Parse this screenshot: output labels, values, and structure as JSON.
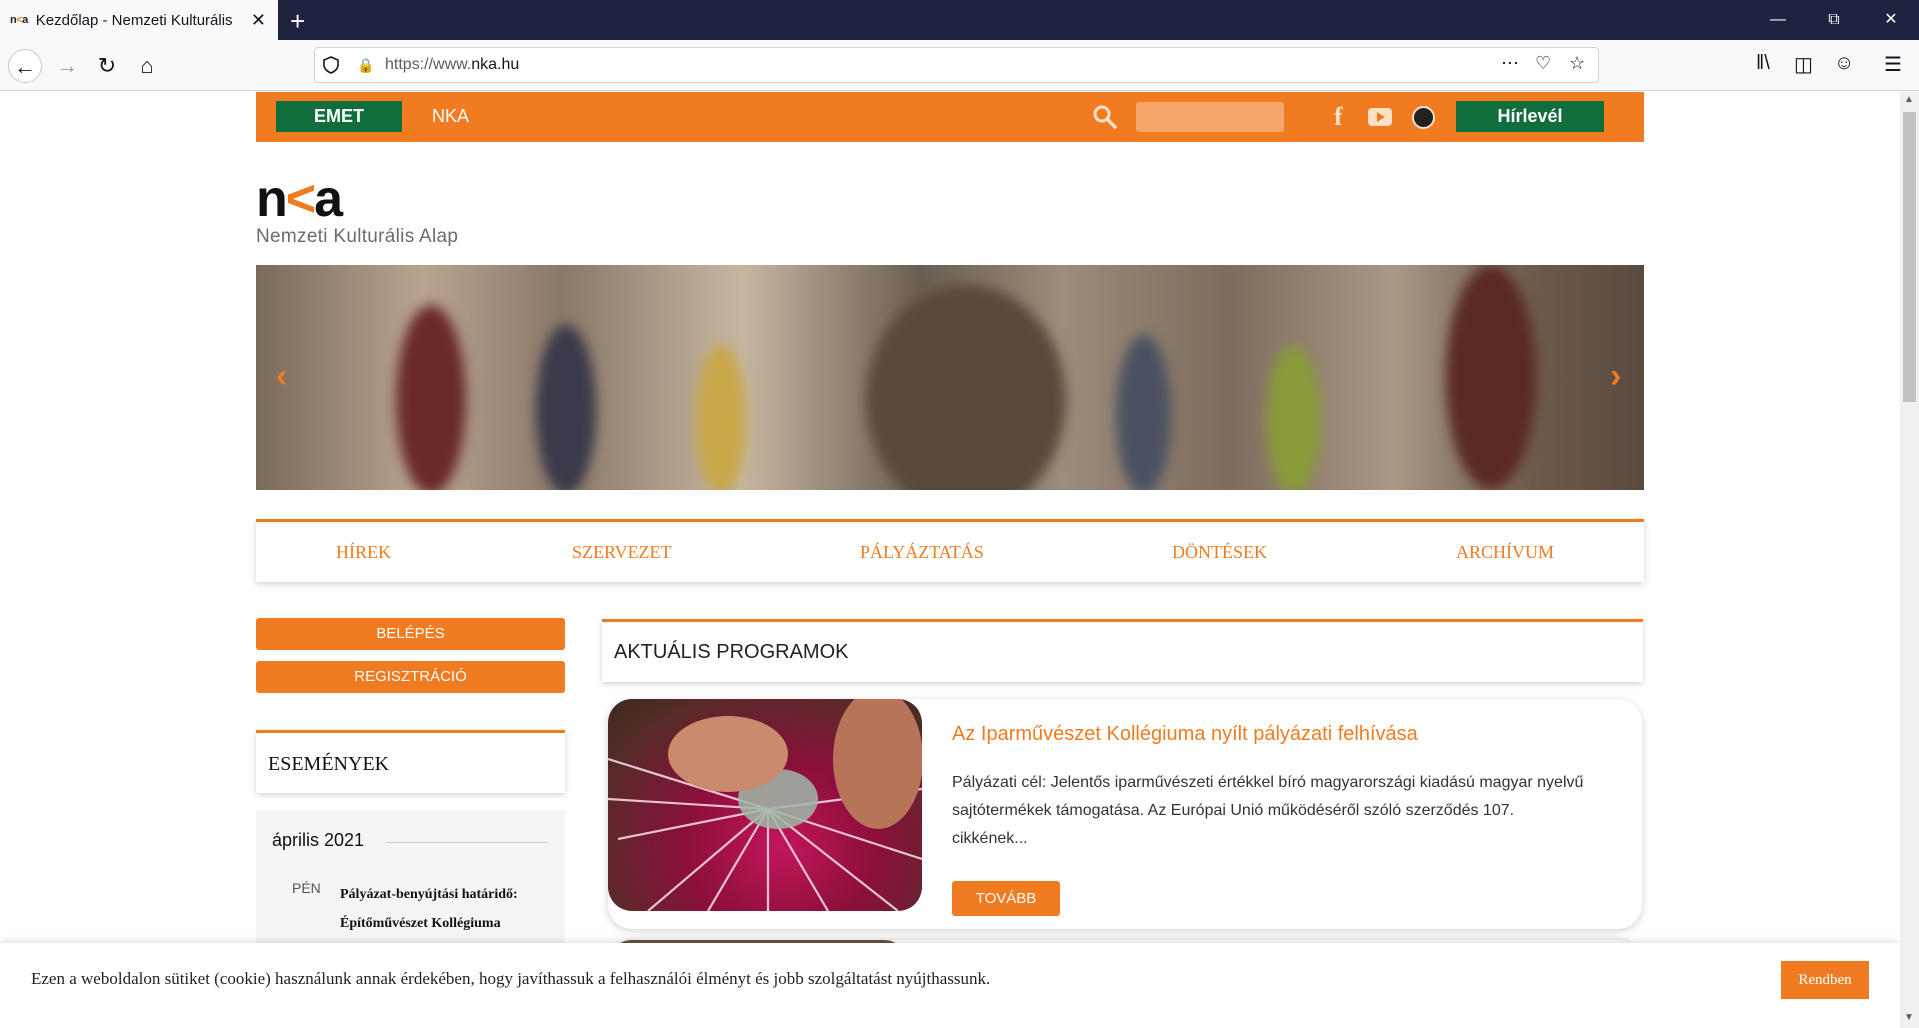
{
  "browser": {
    "tab_title": "Kezdőlap - Nemzeti Kulturális Alap",
    "url_prefix": "https://www.",
    "url_domain": "nka.hu",
    "new_tab": "+",
    "close_tab": "✕"
  },
  "topbar": {
    "emet_label": "EMET",
    "nka_label": "NKA",
    "search_placeholder": "",
    "facebook": "f",
    "newsletter_label": "Hírlevél"
  },
  "logo": {
    "mark_n": "n",
    "mark_k": "<",
    "mark_a": "a",
    "subtitle": "Nemzeti Kulturális Alap"
  },
  "main_nav": {
    "items": [
      "HÍREK",
      "SZERVEZET",
      "PÁLYÁZTATÁS",
      "DÖNTÉSEK",
      "ARCHÍVUM"
    ]
  },
  "sidebar": {
    "login_label": "BELÉPÉS",
    "register_label": "REGISZTRÁCIÓ",
    "events_title": "ESEMÉNYEK",
    "calendar": {
      "month": "április 2021",
      "day": "PÉN",
      "event_line1": "Pályázat-benyújtási határidő:",
      "event_line2": "Építőművészet Kollégiuma"
    }
  },
  "programs": {
    "title": "AKTUÁLIS PROGRAMOK",
    "cards": [
      {
        "title": "Az Iparművészet Kollégiuma nyílt pályázati felhívása",
        "description": "Pályázati cél: Jelentős iparművészeti értékkel bíró magyarországi kiadású magyar nyelvű sajtótermékek támogatása. Az Európai Unió működéséről szóló szerződés 107. cikkének...",
        "more_label": "TOVÁBB"
      }
    ]
  },
  "cookie": {
    "text": "Ezen a weboldalon sütiket (cookie) használunk annak érdekében, hogy javíthassuk a felhasználói élményt és jobb szolgáltatást nyújthassunk.",
    "ok_label": "Rendben"
  },
  "colors": {
    "accent": "#f07b21",
    "green": "#0f6e3c",
    "titlebar": "#202340"
  }
}
